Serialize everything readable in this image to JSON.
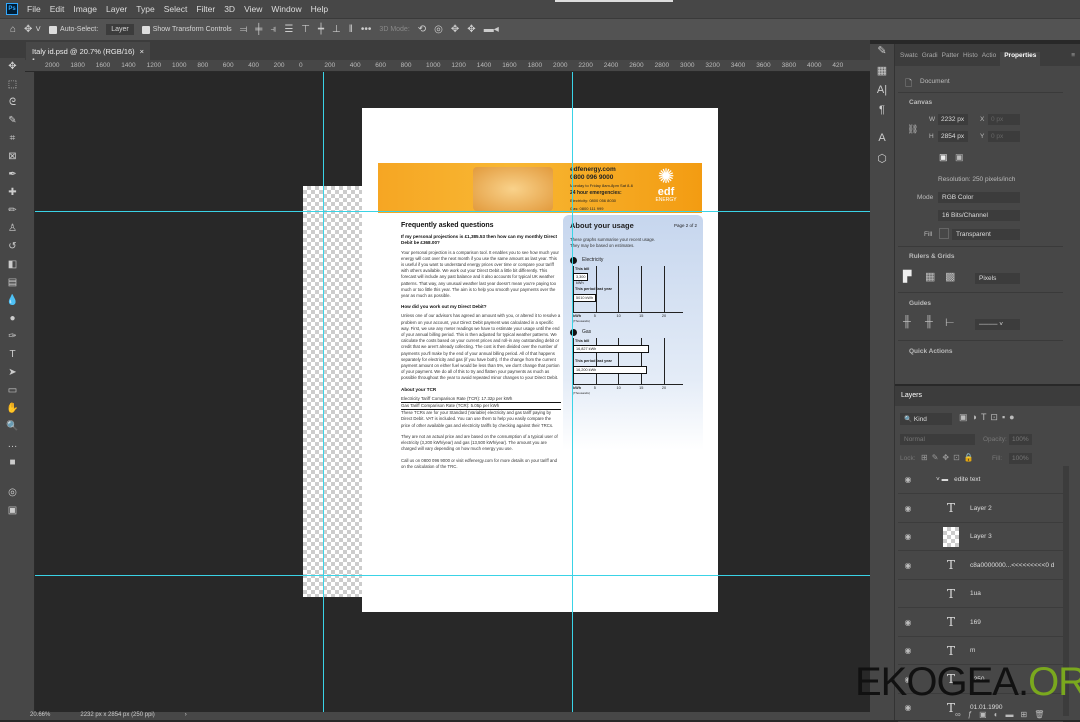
{
  "menu": [
    "File",
    "Edit",
    "Image",
    "Layer",
    "Type",
    "Select",
    "Filter",
    "3D",
    "View",
    "Window",
    "Help"
  ],
  "app_icon": "Ps",
  "options": {
    "auto_select": "Auto-Select:",
    "layer_select": "Layer",
    "show_transform": "Show Transform Controls",
    "more": "•••",
    "mode_3d": "3D Mode:"
  },
  "doc_tab": {
    "title": "Italy id.psd @ 20.7% (RGB/16) *",
    "close": "×"
  },
  "ruler_labels": [
    "2000",
    "1800",
    "1600",
    "1400",
    "1200",
    "1000",
    "800",
    "600",
    "400",
    "200",
    "0",
    "200",
    "400",
    "600",
    "800",
    "1000",
    "1200",
    "1400",
    "1600",
    "1800",
    "2000",
    "2200",
    "2400",
    "2600",
    "2800",
    "3000",
    "3200",
    "3400",
    "3600",
    "3800",
    "4000",
    "420"
  ],
  "tools": [
    "move-icon",
    "marquee-icon",
    "lasso-icon",
    "quick-select-icon",
    "crop-icon",
    "frame-icon",
    "eyedropper-icon",
    "healing-icon",
    "brush-icon",
    "stamp-icon",
    "history-brush-icon",
    "eraser-icon",
    "gradient-icon",
    "blur-icon",
    "dodge-icon",
    "pen-icon",
    "type-icon",
    "path-select-icon",
    "rectangle-icon",
    "hand-icon",
    "zoom-icon",
    "more-icon",
    "colors-icon",
    "quickmask-icon",
    "screen-mode-icon"
  ],
  "tool_glyphs": [
    "✥",
    "⬚",
    "ᘓ",
    "✎",
    "⌗",
    "⊠",
    "✒",
    "✚",
    "✏",
    "♙",
    "↺",
    "◧",
    "▤",
    "💧",
    "●",
    "✑",
    "T",
    "➤",
    "▭",
    "✋",
    "🔍",
    "…",
    "■",
    "◎",
    "▣"
  ],
  "status": {
    "zoom": "20.66%",
    "info": "2232 px x 2854 px (250 ppi)",
    "arrow": "›"
  },
  "doc": {
    "banner": {
      "web": "edfenergy.com",
      "phone": "0800 096 9000",
      "small": "Monday to Friday 8am-8pm Sat 8-6",
      "emergency": "24 hour emergencies:",
      "elec": "Electricity: 0800 056 8030",
      "gas": "Gas: 0800 111 999",
      "brand": "edf",
      "brand_sub": "ENERGY"
    },
    "faq_title": "Frequently asked questions",
    "q1": "If my personal projections is £1,385.53 then how can my monthly Direct Debit be £368.00?",
    "a1": "Your personal projection is a comparison tool. It enables you to see how much your energy will cost over the next month if you use the same amount as last year. This is useful if you want to understand energy prices over time or compare your tariff with others available. We work out your Direct Debit a little bit differently. This forecast will include any past balance and it also accounts for typical UK weather patterns. That way, any unusual weather last year doesn't mean you're paying too much or too little this year. The aim is to help you smooth your payments over the year as much as possible.",
    "q2": "How did you work out my Direct Debit?",
    "a2": "Unless one of our advisors has agreed an amount with you, or altered it to resolve a problem on your account, your Direct Debit payment was calculated in a specific way. First, we use any meter readings we have to estimate your usage until the end of your annual billing period. This is then adjusted for typical weather patterns. We calculate the costs based on your current prices and roll-in any outstanding debit or credit that we aren't already collecting. The cost is then divided over the number of payments you'll make by the end of your annual billing period. All of that happens separately for electricity and gas (if you have both). If the change from the current payment amount on either fuel would be less than 5%, we don't change that portion of your payment. We do all of this to try and flatten your payments as much as possible throughout the year to avoid repeated minor changes to your Direct Debit.",
    "tcr_title": "About your TCR",
    "tcr_elec": "Electricity Tariff Comparison Rate (TCR): 17.32p per kWh",
    "tcr_gas": "Gas Tariff Comparison Rate (TCR): 5.05p per kWh",
    "a3": "These TCRs are for your Standard (Variable) electricity and gas tariff paying by Direct Debit. VAT is included. You can use them to help you easily compare the price of other available gas and electricity tariffs by checking against their TRCs.",
    "a4": "They are not an actual price and are based on the consumption of a typical user of electricity (3,200 kWh/year) and gas (13,500 kWh/year). The amount you are charged will vary depending on how much energy you use.",
    "a5": "Call us on 0800 096 9000 or visit edfenergy.com for more details on your tariff and on the calculation of the TRC.",
    "usage_title": "About your usage",
    "page": "Page 2 of 2",
    "usage_intro": "These graphs summarise your recent usage. They may be based on estimates.",
    "elec_label": "Electricity",
    "gas_label": "Gas",
    "this_bill": "This bill",
    "last_year": "This period last year",
    "elec_this": "3,300 kWh",
    "elec_last": "5010 kWh",
    "gas_this": "16,827 kWh",
    "gas_last": "16,200 kWh",
    "unit": "kWh",
    "unit_sub": "(Thousands)",
    "ticks": [
      "5",
      "10",
      "15",
      "20"
    ]
  },
  "chart_data": [
    {
      "type": "bar",
      "title": "Electricity",
      "categories": [
        "This bill",
        "This period last year"
      ],
      "values": [
        3.3,
        5.01
      ],
      "xlabel": "kWh (Thousands)",
      "xlim": [
        0,
        22
      ]
    },
    {
      "type": "bar",
      "title": "Gas",
      "categories": [
        "This bill",
        "This period last year"
      ],
      "values": [
        16.827,
        16.2
      ],
      "xlabel": "kWh (Thousands)",
      "xlim": [
        0,
        22
      ]
    }
  ],
  "props": {
    "tabs": [
      "Swatc",
      "Gradi",
      "Patter",
      "Histo",
      "Actio",
      "Properties"
    ],
    "document": "Document",
    "canvas": "Canvas",
    "w_label": "W",
    "w": "2232 px",
    "h_label": "H",
    "h": "2854 px",
    "x_label": "X",
    "x": "0 px",
    "y_label": "Y",
    "y": "0 px",
    "resolution": "Resolution: 250 pixels/inch",
    "mode_label": "Mode",
    "mode": "RGB Color",
    "depth": "16 Bits/Channel",
    "fill_label": "Fill",
    "fill": "Transparent",
    "rulers": "Rulers & Grids",
    "units": "Pixels",
    "guides": "Guides",
    "quick": "Quick Actions"
  },
  "layers": {
    "title": "Layers",
    "kind": "Kind",
    "blend": "Normal",
    "opacity_label": "Opacity:",
    "opacity": "100%",
    "lock_label": "Lock:",
    "fill_label": "Fill:",
    "fill": "100%",
    "items": [
      {
        "name": "edite text",
        "type": "group"
      },
      {
        "name": "Layer 2",
        "type": "text"
      },
      {
        "name": "Layer 3",
        "type": "image"
      },
      {
        "name": "c8a0000000...<<<<<<<<<0 d",
        "type": "text"
      },
      {
        "name": "1ua",
        "type": "text",
        "hidden": true
      },
      {
        "name": "169",
        "type": "text"
      },
      {
        "name": "m",
        "type": "text"
      },
      {
        "name": "1250",
        "type": "text"
      },
      {
        "name": "01.01.1990",
        "type": "text"
      }
    ]
  },
  "watermark": {
    "a": "EKOGEA.",
    "b": "ORG"
  }
}
